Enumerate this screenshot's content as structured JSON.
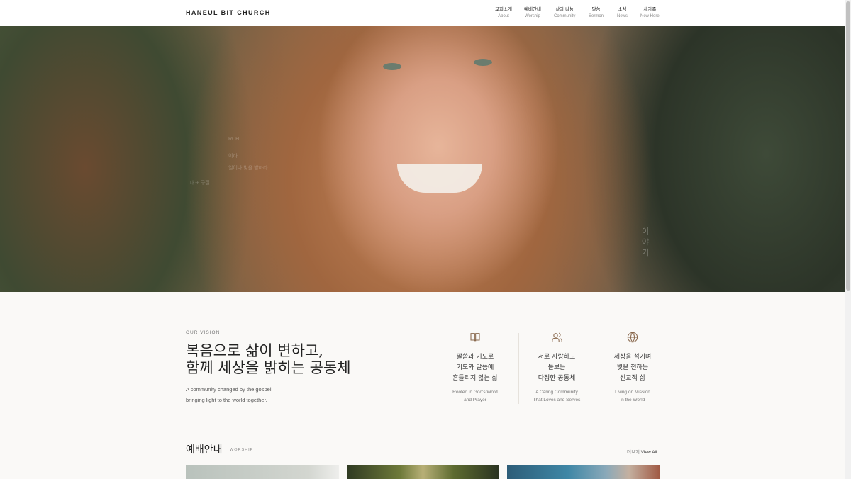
{
  "header": {
    "logo": "HANEUL BIT CHURCH",
    "nav": [
      {
        "ko": "교회소개",
        "en": "About"
      },
      {
        "ko": "예배안내",
        "en": "Worship"
      },
      {
        "ko": "삶과 나눔",
        "en": "Community"
      },
      {
        "ko": "말씀",
        "en": "Sermon"
      },
      {
        "ko": "소식",
        "en": "News"
      },
      {
        "ko": "새가족",
        "en": "New Here"
      }
    ]
  },
  "hero": {
    "overlay_lines": [
      "RCH",
      "이라",
      "일어나 빛을 발하라",
      "대표 구절"
    ],
    "vertical_text": "이야기"
  },
  "vision": {
    "eyebrow": "OUR VISION",
    "title_line1": "복음으로 삶이 변하고,",
    "title_line2": "함께 세상을 밝히는 공동체",
    "sub_line1": "A community changed by the gospel,",
    "sub_line2": "bringing light to the world together.",
    "pillars": [
      {
        "icon": "book-icon",
        "ko": [
          "말씀과 기도로",
          "기도와 말씀에",
          "흔들리지 않는 삶"
        ],
        "en": [
          "Rooted in God's Word",
          "and Prayer"
        ]
      },
      {
        "icon": "people-icon",
        "ko": [
          "서로 사랑하고",
          "돌보는",
          "다정한 공동체"
        ],
        "en": [
          "A Caring Community",
          "That Loves and Serves"
        ]
      },
      {
        "icon": "globe-icon",
        "ko": [
          "세상을 섬기며",
          "빛을 전하는",
          "선교적 삶"
        ],
        "en": [
          "Living on Mission",
          "in the World"
        ]
      }
    ]
  },
  "worship": {
    "title": "예배안내",
    "tag": "WORSHIP",
    "more_ko": "더보기",
    "more_en": "View All"
  },
  "colors": {
    "accent": "#8a6a4f",
    "text": "#222222",
    "muted": "#777777",
    "background": "#faf9f7"
  }
}
